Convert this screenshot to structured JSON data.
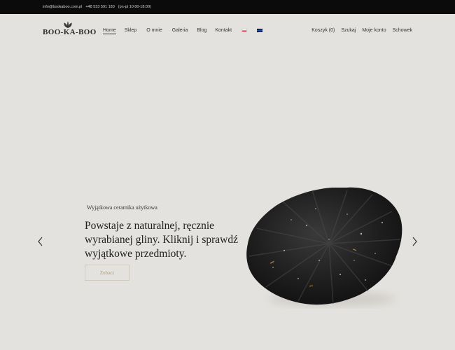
{
  "topbar": {
    "email": "info@bookaboo.com.pl",
    "phone": "+48 533 591 180",
    "hours": "(pn-pt 10:00-18:00)"
  },
  "brand": {
    "logo_text": "BOO-KA-BOO"
  },
  "nav": {
    "items": [
      {
        "label": "Home",
        "active": true
      },
      {
        "label": "Sklep"
      },
      {
        "label": "O mnie"
      },
      {
        "label": "Galeria"
      },
      {
        "label": "Blog"
      },
      {
        "label": "Kontakt"
      }
    ],
    "languages": [
      {
        "code": "pl",
        "icon": "flag-poland-icon"
      },
      {
        "code": "en",
        "icon": "flag-uk-icon"
      }
    ]
  },
  "account_nav": {
    "cart": "Koszyk (0)",
    "search": "Szukaj",
    "account": "Moje konto",
    "wishlist": "Schowek"
  },
  "hero": {
    "subtitle": "Wyjątkowa ceramika użytkowa",
    "title": "Powstaje z naturalnej, ręcznie wyrabianej gliny. Kliknij i sprawdź wyjątkowe przedmioty.",
    "button_label": "Zobacz",
    "prev_icon": "chevron-left-icon",
    "next_icon": "chevron-right-icon"
  },
  "colors": {
    "background": "#e4e2de",
    "topbar": "#0b0b0b",
    "accent": "#b99a6c"
  }
}
